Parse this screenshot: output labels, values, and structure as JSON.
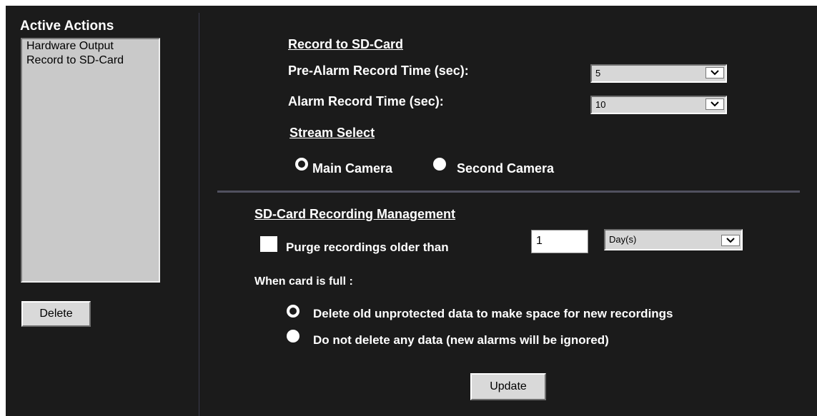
{
  "left_panel": {
    "title": "Active Actions",
    "actions": [
      "Hardware Output",
      "Record to SD-Card"
    ],
    "delete_label": "Delete"
  },
  "record": {
    "heading": "Record to SD-Card",
    "pre_alarm_label": "Pre-Alarm Record Time (sec):",
    "pre_alarm_value": "5",
    "alarm_label": "Alarm Record Time (sec):",
    "alarm_value": "10",
    "stream_heading": "Stream Select",
    "stream_options": [
      "Main Camera",
      "Second Camera"
    ],
    "stream_selected": "Main Camera"
  },
  "management": {
    "heading": "SD-Card Recording Management",
    "purge_label": "Purge recordings older than",
    "purge_checked": false,
    "purge_value": "1",
    "purge_unit": "Day(s)",
    "full_label": "When card is full :",
    "full_options": [
      "Delete old unprotected data to make space for new recordings",
      "Do not delete any data (new alarms will be ignored)"
    ],
    "full_selected": "Delete old unprotected data to make space for new recordings"
  },
  "update_label": "Update",
  "icons": {
    "dropdown": "chevron-down-icon"
  },
  "colors": {
    "background": "#1b1b1b",
    "list_bg": "#c9c9c9",
    "button_bg": "#d9d9d9",
    "separator": "#51515f"
  }
}
